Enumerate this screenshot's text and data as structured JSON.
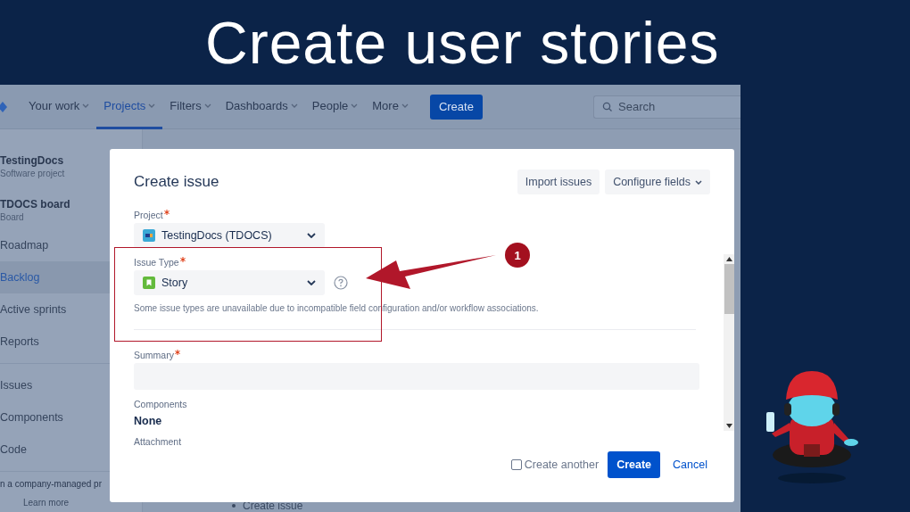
{
  "slide_title": "Create user stories",
  "nav": {
    "items": [
      {
        "label": "Your work",
        "selected": false
      },
      {
        "label": "Projects",
        "selected": true
      },
      {
        "label": "Filters",
        "selected": false
      },
      {
        "label": "Dashboards",
        "selected": false
      },
      {
        "label": "People",
        "selected": false
      },
      {
        "label": "More",
        "selected": false
      }
    ],
    "create_button": "Create",
    "search": {
      "placeholder": "Search"
    }
  },
  "sidebar": {
    "project": {
      "name": "TestingDocs",
      "type": "Software project"
    },
    "board": {
      "name": "TDOCS board",
      "type": "Board"
    },
    "items": [
      {
        "label": "Roadmap",
        "selected": false
      },
      {
        "label": "Backlog",
        "selected": true
      },
      {
        "label": "Active sprints",
        "selected": false
      },
      {
        "label": "Reports",
        "selected": false
      }
    ],
    "items_2": [
      {
        "label": "Issues",
        "selected": false
      },
      {
        "label": "Components",
        "selected": false
      },
      {
        "label": "Code",
        "selected": false
      }
    ],
    "footer_text": "n a company-managed pr",
    "footer_link": "Learn more"
  },
  "background_list": [
    "Create issue"
  ],
  "dialog": {
    "title": "Create issue",
    "header_buttons": [
      {
        "label": "Import issues",
        "dropdown": false
      },
      {
        "label": "Configure fields",
        "dropdown": true
      }
    ],
    "fields": [
      {
        "kind": "project_select",
        "label": "Project",
        "required": true,
        "value": "TestingDocs (TDOCS)",
        "help": false
      },
      {
        "kind": "type_select",
        "label": "Issue Type",
        "required": true,
        "value": "Story",
        "help": true,
        "hint": "Some issue types are unavailable due to incompatible field configuration and/or workflow associations."
      },
      {
        "kind": "input",
        "label": "Summary",
        "required": true
      },
      {
        "kind": "value",
        "label": "Components",
        "required": false,
        "value": "None"
      },
      {
        "kind": "label",
        "label": "Attachment",
        "required": false
      }
    ],
    "create_another": {
      "label": "Create another",
      "checked": false
    },
    "create_button": "Create",
    "cancel_link": "Cancel"
  },
  "annotation": {
    "number": "1"
  }
}
